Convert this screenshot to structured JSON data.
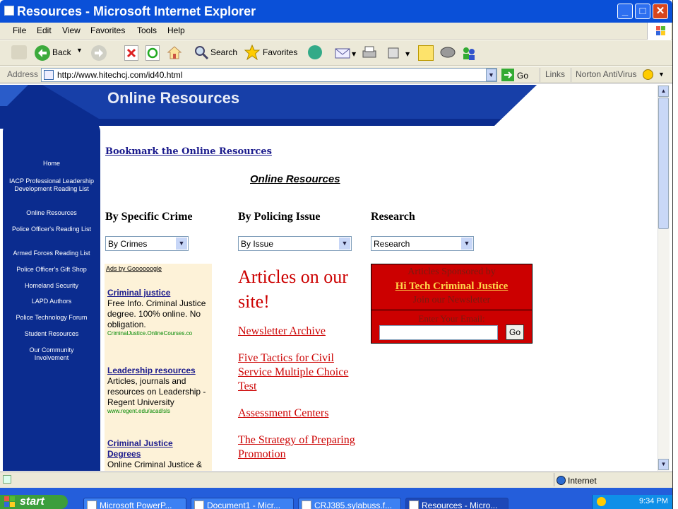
{
  "window": {
    "title": "Resources - Microsoft Internet Explorer",
    "min_label": "_",
    "max_label": "□",
    "close_label": "✕"
  },
  "menu": [
    "File",
    "Edit",
    "View",
    "Favorites",
    "Tools",
    "Help"
  ],
  "toolbar": {
    "back": "Back",
    "search": "Search",
    "favorites": "Favorites"
  },
  "address": {
    "label": "Address",
    "url": "http://www.hitechcj.com/id40.html",
    "go": "Go",
    "links": "Links",
    "norton": "Norton AntiVirus"
  },
  "site": {
    "banner_title": "Online Resources",
    "nav": [
      "Home",
      "IACP Professional Leadership Development Reading List",
      "Online Resources",
      "Police Officer's Reading List",
      "Armed Forces Reading List",
      "Police Officer's Gift Shop",
      "Homeland Security",
      "LAPD Authors",
      "Police Technology Forum",
      "Student Resources",
      "Our Community Involvement"
    ],
    "bookmark": "Bookmark the Online Resources",
    "heading": "Online Resources",
    "columns": [
      {
        "header": "By Specific Crime",
        "select": "By Crimes"
      },
      {
        "header": "By Policing Issue",
        "select": "By Issue"
      },
      {
        "header": "Research",
        "select": "Research"
      }
    ],
    "ads": {
      "header": "Ads by Goooooogle",
      "items": [
        {
          "title": "Criminal justice",
          "body": "Free Info. Criminal Justice degree. 100% online. No obligation.",
          "url": "CriminalJustice.OnlineCourses.co"
        },
        {
          "title": "Leadership resources",
          "body": "Articles, journals and resources on Leadership - Regent University",
          "url": "www.regent.edu/acad/sls"
        },
        {
          "title": "Criminal Justice Degrees",
          "body": "Online Criminal Justice &",
          "url": ""
        }
      ]
    },
    "articles": {
      "title": "Articles on our site!",
      "links": [
        "Newsletter Archive",
        "Five Tactics for Civil Service Multiple Choice Test",
        "Assessment Centers",
        "The Strategy of Preparing Promotion"
      ]
    },
    "newsletter": {
      "line1": "Articles Sponsored by",
      "link": "Hi Tech Criminal Justice",
      "line3": "Join our Newsletter",
      "email_label": "Enter Your Email:",
      "go": "Go"
    }
  },
  "status": {
    "zone": "Internet"
  },
  "taskbar": {
    "start": "start",
    "tasks": [
      "Microsoft PowerP...",
      "Document1 - Micr...",
      "CRJ385.sylabuss.f...",
      "Resources - Micro..."
    ],
    "time": "9:34 PM"
  },
  "colors": {
    "ie_blue": "#0a50d8",
    "site_navy": "#0b2c8f",
    "article_red": "#cc0000",
    "ad_bg": "#fdf2d8"
  }
}
